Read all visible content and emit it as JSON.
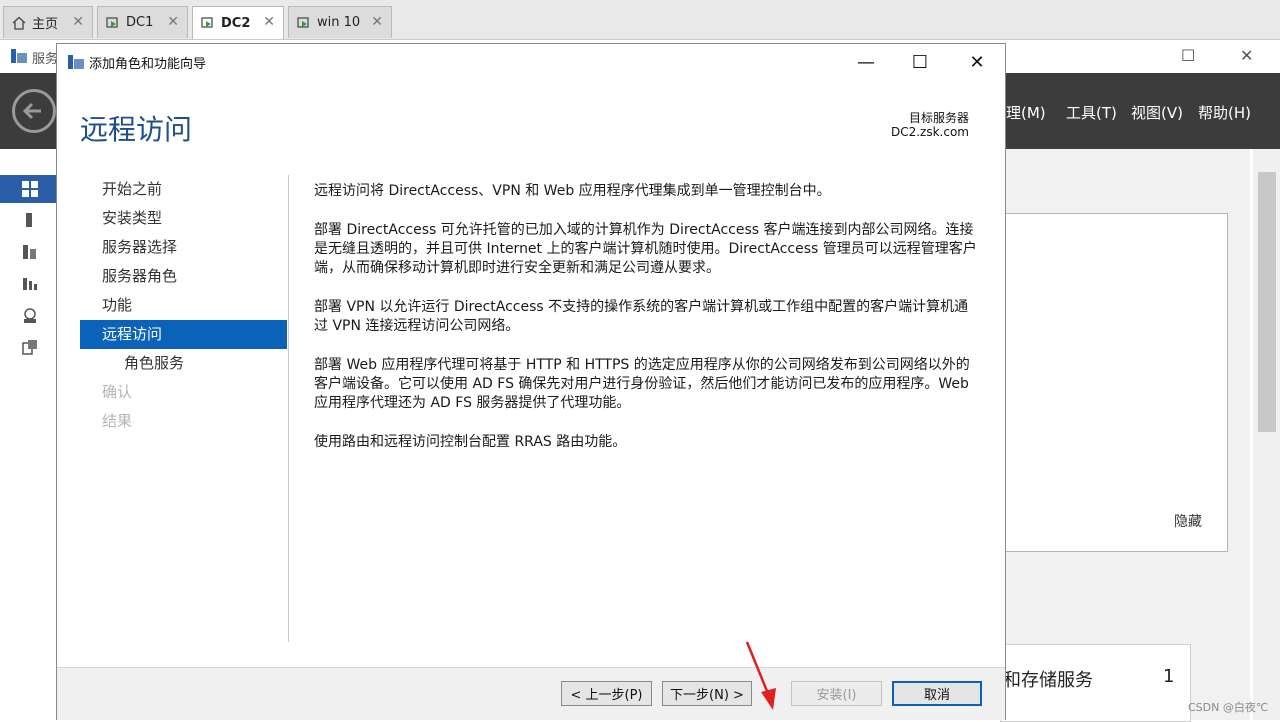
{
  "vm_tabs": [
    {
      "label": "主页",
      "icon": "home-icon",
      "active": false
    },
    {
      "label": "DC1",
      "icon": "vm-icon",
      "active": false
    },
    {
      "label": "DC2",
      "icon": "vm-icon",
      "active": true
    },
    {
      "label": "win 10",
      "icon": "vm-icon",
      "active": false
    }
  ],
  "background_app": {
    "title": "服务",
    "menu": [
      "理(M)",
      "工具(T)",
      "视图(V)",
      "帮助(H)"
    ],
    "hide_label": "隐藏",
    "tile_title": "和存储服务",
    "tile_count": "1"
  },
  "wizard": {
    "title": "添加角色和功能向导",
    "page_title": "远程访问",
    "target_label": "目标服务器",
    "target_value": "DC2.zsk.com",
    "nav": [
      {
        "label": "开始之前",
        "state": "normal"
      },
      {
        "label": "安装类型",
        "state": "normal"
      },
      {
        "label": "服务器选择",
        "state": "normal"
      },
      {
        "label": "服务器角色",
        "state": "normal"
      },
      {
        "label": "功能",
        "state": "normal"
      },
      {
        "label": "远程访问",
        "state": "active"
      },
      {
        "label": "角色服务",
        "state": "sub"
      },
      {
        "label": "确认",
        "state": "disabled"
      },
      {
        "label": "结果",
        "state": "disabled"
      }
    ],
    "paragraphs": [
      "远程访问将 DirectAccess、VPN 和 Web 应用程序代理集成到单一管理控制台中。",
      "部署 DirectAccess 可允许托管的已加入域的计算机作为 DirectAccess 客户端连接到内部公司网络。连接是无缝且透明的，并且可供 Internet 上的客户端计算机随时使用。DirectAccess 管理员可以远程管理客户端，从而确保移动计算机即时进行安全更新和满足公司遵从要求。",
      "部署 VPN 以允许运行 DirectAccess 不支持的操作系统的客户端计算机或工作组中配置的客户端计算机通过 VPN 连接远程访问公司网络。",
      "部署 Web 应用程序代理可将基于 HTTP 和 HTTPS 的选定应用程序从你的公司网络发布到公司网络以外的客户端设备。它可以使用 AD FS 确保先对用户进行身份验证，然后他们才能访问已发布的应用程序。Web 应用程序代理还为 AD FS 服务器提供了代理功能。",
      "使用路由和远程访问控制台配置 RRAS 路由功能。"
    ],
    "buttons": {
      "prev": "< 上一步(P)",
      "next": "下一步(N) >",
      "install": "安装(I)",
      "cancel": "取消"
    }
  },
  "watermark": "CSDN @白夜℃",
  "colors": {
    "accent": "#0a63b8",
    "page_title": "#1c4f8c",
    "menubar": "#3c3c3c",
    "annotation_arrow": "#e02020"
  }
}
